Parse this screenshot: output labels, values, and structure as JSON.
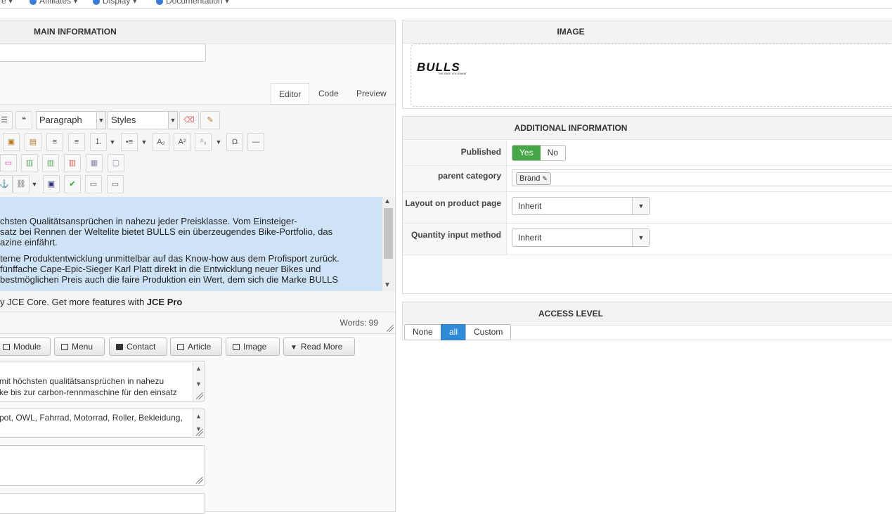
{
  "topnav": {
    "items": [
      "re",
      "Affiliates",
      "Display",
      "Documentation"
    ]
  },
  "main_info": {
    "title": "MAIN INFORMATION",
    "tabs": [
      "Editor",
      "Code",
      "Preview"
    ],
    "toolbar": {
      "block_format": "Paragraph",
      "styles": "Styles"
    },
    "content_lines": [
      "chsten Qualitätsansprüchen in nahezu jeder Preisklasse. Vom Einsteiger-",
      "satz bei Rennen der Weltelite bietet BULLS ein überzeugendes Bike-Portfolio, das",
      "azine einfährt.",
      "terne Produktentwicklung unmittelbar auf das Know-how aus dem Profisport zurück.",
      " fünffache Cape-Epic-Sieger Karl Platt direkt in die Entwicklung neuer Bikes und",
      "bestmöglichen Preis auch die faire Produktion ein Wert, dem sich die Marke BULLS"
    ],
    "jce_text": "y JCE Core. Get more features with ",
    "jce_pro": "JCE Pro",
    "word_count": "Words: 99",
    "buttons": [
      "Module",
      "Menu",
      "Contact",
      "Article",
      "Image",
      "Read More"
    ],
    "meta_description": [
      "mit höchsten qualitätsansprüchen in nahezu",
      "ke bis zur carbon-rennmaschine für den einsatz"
    ],
    "meta_keywords": "pot, OWL, Fahrrad, Motorrad, Roller, Bekleidung,"
  },
  "image": {
    "title": "IMAGE",
    "logo_text": "BULLS",
    "logo_tagline": "THE BIKE YOU WANT"
  },
  "additional": {
    "title": "ADDITIONAL INFORMATION",
    "published_label": "Published",
    "published_yes": "Yes",
    "published_no": "No",
    "parent_label": "parent category",
    "parent_value": "Brand",
    "layout_label": "Layout on product page",
    "layout_value": "Inherit",
    "qty_label": "Quantity input method",
    "qty_value": "Inherit"
  },
  "access": {
    "title": "ACCESS LEVEL",
    "options": [
      "None",
      "all",
      "Custom"
    ],
    "selected": "all"
  },
  "colors": {
    "accent": "#2f8bd6",
    "yes_green": "#46a546",
    "selection": "#cfe3f7"
  }
}
